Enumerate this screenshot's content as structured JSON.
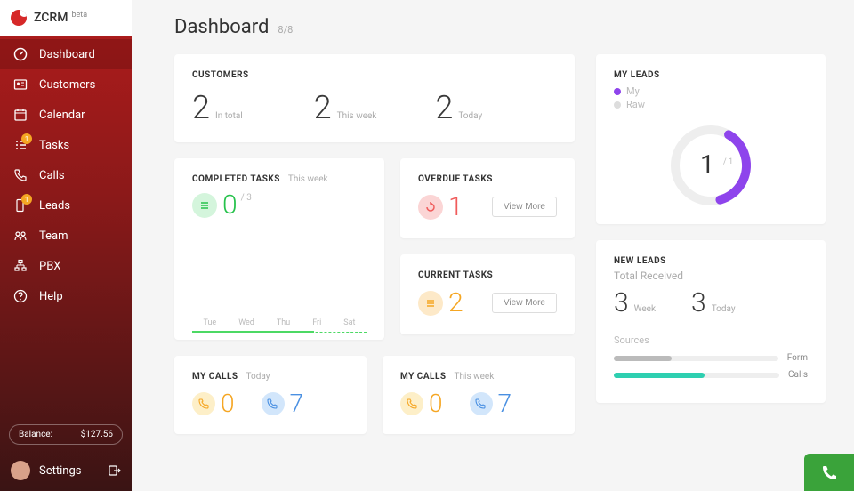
{
  "app": {
    "name": "ZCRM",
    "badge": "beta"
  },
  "sidebar": {
    "items": [
      {
        "label": "Dashboard",
        "icon": "gauge-icon",
        "active": true
      },
      {
        "label": "Customers",
        "icon": "id-card-icon"
      },
      {
        "label": "Calendar",
        "icon": "calendar-icon"
      },
      {
        "label": "Tasks",
        "icon": "tasks-icon",
        "badge": "1"
      },
      {
        "label": "Calls",
        "icon": "phone-icon"
      },
      {
        "label": "Leads",
        "icon": "leads-icon",
        "badge": "1"
      },
      {
        "label": "Team",
        "icon": "team-icon"
      },
      {
        "label": "PBX",
        "icon": "pbx-icon"
      },
      {
        "label": "Help",
        "icon": "help-icon"
      }
    ],
    "balance_label": "Balance:",
    "balance_value": "$127.56",
    "settings_label": "Settings"
  },
  "page": {
    "title": "Dashboard",
    "count": "8/8"
  },
  "customers": {
    "heading": "CUSTOMERS",
    "metrics": [
      {
        "value": "2",
        "label": "In total"
      },
      {
        "value": "2",
        "label": "This week"
      },
      {
        "value": "2",
        "label": "Today"
      }
    ]
  },
  "completed_tasks": {
    "heading": "COMPLETED TASKS",
    "period": "This week",
    "value": "0",
    "of": "/ 3",
    "axis": [
      "Tue",
      "Wed",
      "Thu",
      "Fri",
      "Sat"
    ]
  },
  "overdue_tasks": {
    "heading": "OVERDUE TASKS",
    "value": "1",
    "button": "View More"
  },
  "current_tasks": {
    "heading": "CURRENT TASKS",
    "value": "2",
    "button": "View More"
  },
  "my_calls_today": {
    "heading": "MY CALLS",
    "period": "Today",
    "out": "0",
    "in": "7"
  },
  "my_calls_week": {
    "heading": "MY CALLS",
    "period": "This week",
    "out": "0",
    "in": "7"
  },
  "my_leads": {
    "heading": "MY LEADS",
    "legend": [
      {
        "label": "My",
        "color": "#8e44ec"
      },
      {
        "label": "Raw",
        "color": "#dddddd"
      }
    ],
    "value": "1",
    "of": "/ 1"
  },
  "new_leads": {
    "heading": "NEW LEADS",
    "subtitle": "Total Received",
    "metrics": [
      {
        "value": "3",
        "label": "Week"
      },
      {
        "value": "3",
        "label": "Today"
      }
    ],
    "sources_label": "Sources",
    "sources": [
      {
        "label": "Form",
        "pct": 35,
        "color": "#bbbbbb"
      },
      {
        "label": "Calls",
        "pct": 55,
        "color": "#2ecfb0"
      }
    ]
  },
  "colors": {
    "green": "#27c24c",
    "red": "#f05b5b",
    "orange": "#f5a623",
    "blue": "#4a90e2",
    "purple": "#8e44ec",
    "teal": "#2ecfb0"
  },
  "chart_data": [
    {
      "type": "line",
      "title": "Completed Tasks (This week)",
      "categories": [
        "Tue",
        "Wed",
        "Thu",
        "Fri",
        "Sat"
      ],
      "values": [
        0,
        0,
        0,
        0,
        0
      ],
      "ylim": [
        0,
        3
      ]
    },
    {
      "type": "pie",
      "title": "My Leads",
      "series": [
        {
          "name": "My",
          "value": 1
        },
        {
          "name": "Raw",
          "value": 0
        }
      ]
    },
    {
      "type": "bar",
      "title": "New Leads Sources",
      "categories": [
        "Form",
        "Calls"
      ],
      "values": [
        35,
        55
      ]
    }
  ]
}
